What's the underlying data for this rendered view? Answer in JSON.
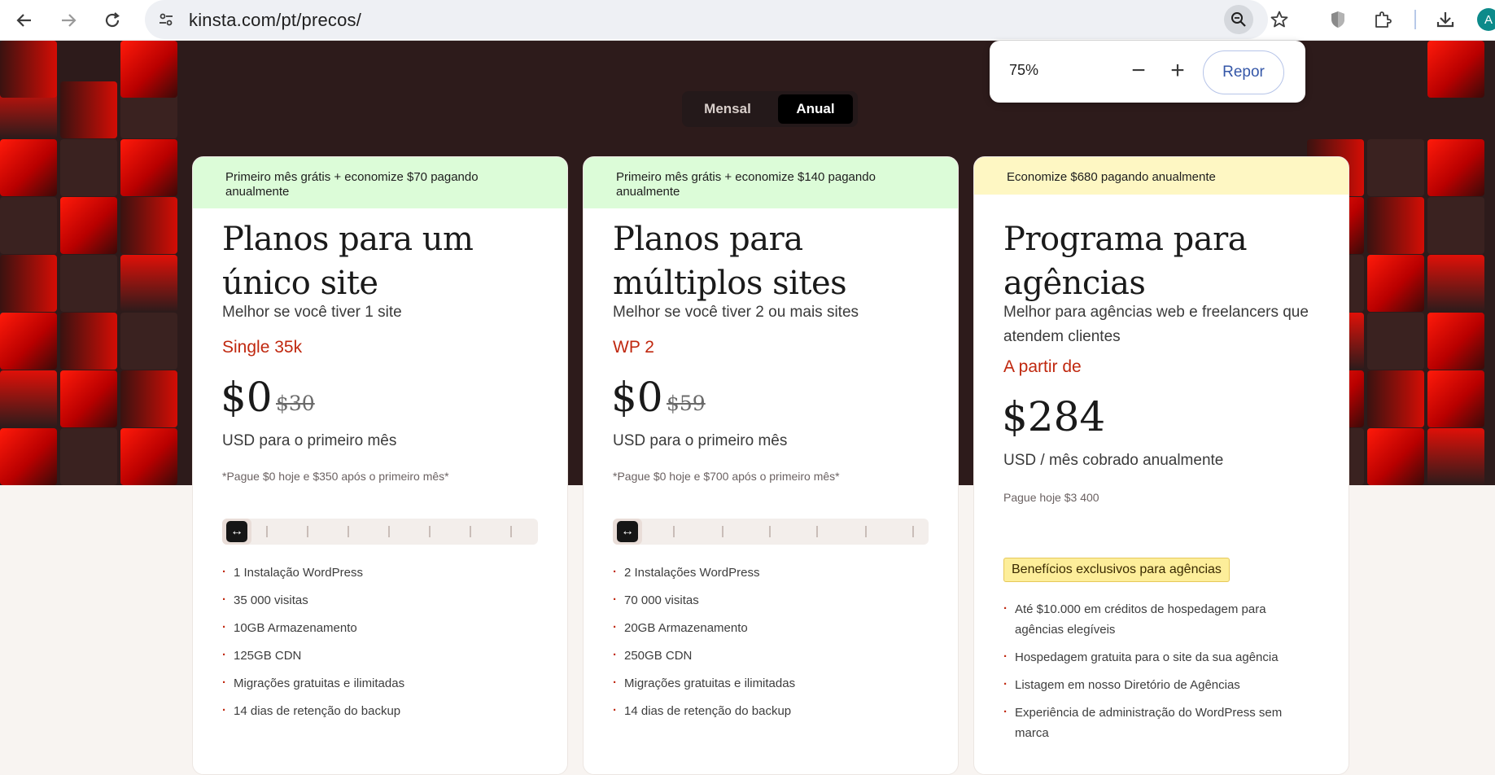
{
  "browser": {
    "url": "kinsta.com/pt/precos/",
    "avatar_initial": "A",
    "zoom": {
      "value": "75%",
      "minus": "−",
      "plus": "+",
      "reset": "Repor"
    }
  },
  "billing_toggle": {
    "monthly": "Mensal",
    "annual": "Anual",
    "selected": "Anual"
  },
  "cards": [
    {
      "banner": "Primeiro mês grátis + economize $70 pagando anualmente",
      "banner_color": "#dcfcd8",
      "title": "Planos para um único site",
      "subtitle": "Melhor se você tiver 1 site",
      "plan_name": "Single 35k",
      "price": "$0",
      "old_price": "$30",
      "price_unit": "USD para o primeiro mês",
      "note": "*Pague $0 hoje e $350 após o primeiro mês*",
      "slider_position": 0,
      "features": [
        "1 Instalação WordPress",
        "35 000 visitas",
        "10GB Armazenamento",
        "125GB CDN",
        "Migrações gratuitas e ilimitadas",
        "14 dias de retenção do backup"
      ]
    },
    {
      "banner": "Primeiro mês grátis + economize $140 pagando anualmente",
      "banner_color": "#dcfcd8",
      "title": "Planos para múltiplos sites",
      "subtitle": "Melhor se você tiver 2 ou mais sites",
      "plan_name": "WP 2",
      "price": "$0",
      "old_price": "$59",
      "price_unit": "USD para o primeiro mês",
      "note": "*Pague $0 hoje e $700 após o primeiro mês*",
      "slider_position": 0,
      "features": [
        "2 Instalações WordPress",
        "70 000 visitas",
        "20GB Armazenamento",
        "250GB CDN",
        "Migrações gratuitas e ilimitadas",
        "14 dias de retenção do backup"
      ]
    },
    {
      "banner": "Economize $680 pagando anualmente",
      "banner_color": "#fef7c3",
      "title": "Programa para agências",
      "subtitle": "Melhor para agências web e freelancers que atendem clientes",
      "plan_name": "A partir de",
      "price": "$284",
      "price_unit": "USD / mês cobrado anualmente",
      "note": "Pague hoje $3 400",
      "badge": "Benefícios exclusivos para agências",
      "features": [
        "Até $10.000 em créditos de hospedagem para agências elegíveis",
        "Hospedagem gratuita para o site da sua agência",
        "Listagem em nosso Diretório de Agências",
        "Experiência de administração do WordPress sem marca"
      ]
    }
  ],
  "colors": {
    "accent_red": "#c0280f",
    "hero_bg": "#2d1b1b"
  }
}
